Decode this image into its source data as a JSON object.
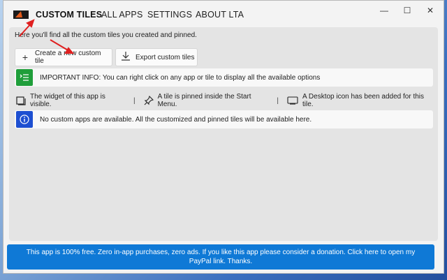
{
  "app": {
    "tabs": [
      "CUSTOM TILES",
      "ALL APPS",
      "SETTINGS",
      "ABOUT LTA"
    ],
    "active_tab": "CUSTOM TILES",
    "window_controls": {
      "minimize": "—",
      "maximize": "☐",
      "close": "✕"
    }
  },
  "main": {
    "intro": "Here you'll find all the custom tiles you created and pinned.",
    "create_button": {
      "label": "Create a new custom tile",
      "icon": "plus-icon"
    },
    "export_button": {
      "label": "Export custom tiles",
      "icon": "download-icon"
    },
    "important_info": {
      "text": "IMPORTANT INFO: You can right click on any app or tile to display all the available options",
      "icon": "list-icon",
      "color": "#1f9e3a"
    },
    "legend": {
      "widget": "The widget of this app is visible.",
      "pinned": "A tile is pinned inside the Start Menu.",
      "desktop": "A Desktop icon has been added for this tile.",
      "separator": "|"
    },
    "no_apps": {
      "text": "No custom apps are available. All the customized and pinned tiles will be available here.",
      "icon": "info-icon",
      "color": "#1d4fd1"
    }
  },
  "footer": {
    "donate_text": "This app is 100% free. Zero in-app purchases, zero ads. If you like this app please consider a donation. Click here to open my PayPal link. Thanks.",
    "color": "#0f79d6"
  },
  "annotations": {
    "arrow_color": "#e02020"
  }
}
